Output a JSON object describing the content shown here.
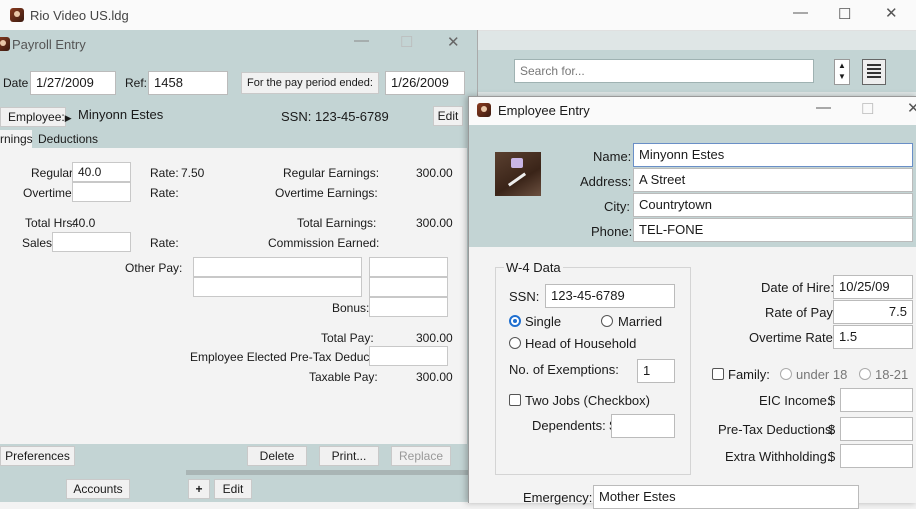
{
  "main_window": {
    "title": "Rio Video US.ldg",
    "search_placeholder": "Search for...",
    "accounts_button": "Accounts",
    "add_button": "+",
    "edit_button": "Edit"
  },
  "payroll": {
    "title": "Payroll Entry",
    "date_label": "Date",
    "date_value": "1/27/2009",
    "ref_label": "Ref:",
    "ref_value": "1458",
    "period_label": "For the pay period ended:",
    "period_value": "1/26/2009",
    "employee_button": "Employee:",
    "employee_name": "Minyonn Estes",
    "ssn_label": "SSN:",
    "ssn_value": "123-45-6789",
    "edit_button": "Edit",
    "tabs": [
      "rnings",
      "Deductions"
    ],
    "regular_label": "Regular:",
    "regular_value": "40.0",
    "rate_label": "Rate:",
    "rate_value": "7.50",
    "overtime_label": "Overtime:",
    "total_hrs_label": "Total Hrs:",
    "total_hrs_value": "40.0",
    "sales_label": "Sales:",
    "regular_earnings_label": "Regular Earnings:",
    "regular_earnings_value": "300.00",
    "overtime_earnings_label": "Overtime Earnings:",
    "total_earnings_label": "Total Earnings:",
    "total_earnings_value": "300.00",
    "commission_label": "Commission Earned:",
    "other_pay_label": "Other Pay:",
    "bonus_label": "Bonus:",
    "total_pay_label": "Total Pay:",
    "total_pay_value": "300.00",
    "pretax_label": "Employee Elected Pre-Tax Deductions:",
    "taxable_label": "Taxable Pay:",
    "taxable_value": "300.00",
    "buttons": {
      "preferences": "Preferences",
      "delete": "Delete",
      "print": "Print...",
      "replace": "Replace"
    }
  },
  "employee": {
    "title": "Employee Entry",
    "name_label": "Name:",
    "name_value": "Minyonn Estes",
    "address_label": "Address:",
    "address_value": "A Street",
    "city_label": "City:",
    "city_value": "Countrytown",
    "phone_label": "Phone:",
    "phone_value": "TEL-FONE",
    "w4_label": "W-4 Data",
    "ssn_label": "SSN:",
    "ssn_value": "123-45-6789",
    "single_label": "Single",
    "married_label": "Married",
    "head_label": "Head of Household",
    "exemptions_label": "No. of Exemptions:",
    "exemptions_value": "1",
    "two_jobs_label": "Two Jobs (Checkbox)",
    "dependents_label": "Dependents: $",
    "hire_label": "Date of Hire:",
    "hire_value": "10/25/09",
    "rate_label": "Rate of Pay:",
    "rate_value": "7.5",
    "ot_rate_label": "Overtime Rate:",
    "ot_rate_value": "1.5",
    "family_label": "Family:",
    "under18_label": "under 18",
    "age1821_label": "18-21",
    "eic_label": "EIC Income:",
    "pretax_label": "Pre-Tax Deductions:",
    "extra_label": "Extra Withholding:",
    "dollar": "$",
    "emergency_label": "Emergency:",
    "emergency_value": "Mother Estes"
  }
}
